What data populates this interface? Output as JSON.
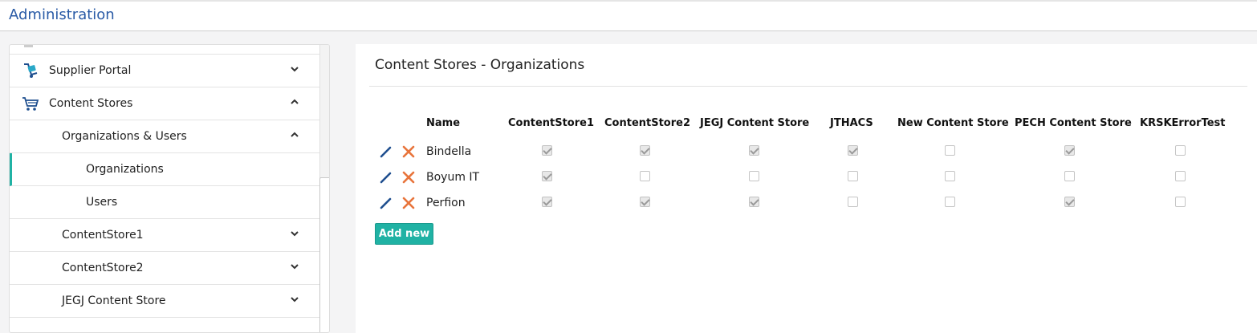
{
  "header": {
    "title": "Administration"
  },
  "sidebar": {
    "items": [
      {
        "label": "Supplier Portal",
        "icon": "supplier-portal-icon",
        "expanded": false
      },
      {
        "label": "Content Stores",
        "icon": "shopping-cart-icon",
        "expanded": true
      },
      {
        "label": "Organizations & Users",
        "expanded": true
      },
      {
        "label": "Organizations",
        "active": true
      },
      {
        "label": "Users"
      },
      {
        "label": "ContentStore1",
        "expanded": false
      },
      {
        "label": "ContentStore2",
        "expanded": false
      },
      {
        "label": "JEGJ Content Store",
        "expanded": false
      }
    ]
  },
  "main": {
    "heading": "Content Stores - Organizations",
    "table": {
      "columns": [
        "Name",
        "ContentStore1",
        "ContentStore2",
        "JEGJ Content Store",
        "JTHACS",
        "New Content Store",
        "PECH Content Store",
        "KRSKErrorTest"
      ],
      "rows": [
        {
          "name": "Bindella",
          "values": [
            true,
            true,
            true,
            true,
            false,
            true,
            false
          ]
        },
        {
          "name": "Boyum IT",
          "values": [
            true,
            false,
            false,
            false,
            false,
            false,
            false
          ]
        },
        {
          "name": "Perfion",
          "values": [
            true,
            true,
            true,
            false,
            false,
            true,
            false
          ]
        }
      ]
    },
    "add_label": "Add new"
  },
  "colors": {
    "accent": "#20b2a4",
    "title": "#2a5ba6",
    "edit": "#1f4f8f",
    "delete": "#e8743b"
  }
}
